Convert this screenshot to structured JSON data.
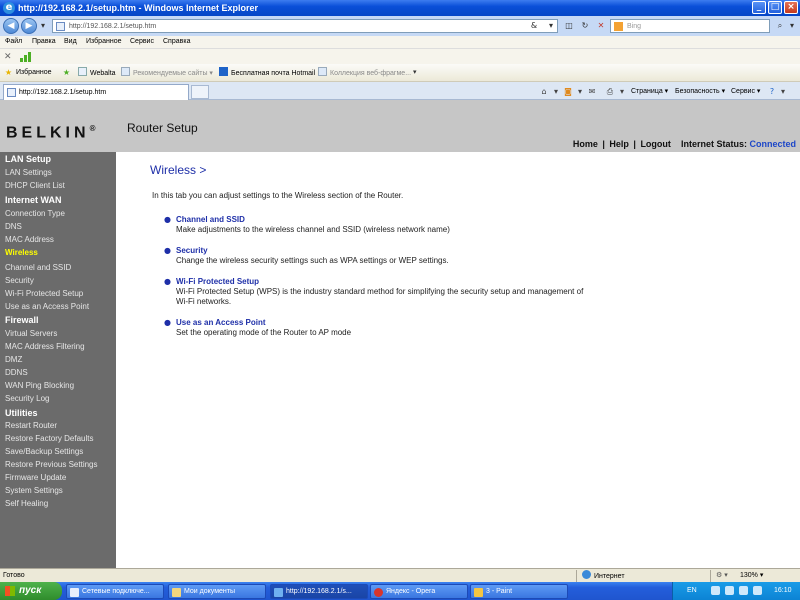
{
  "window": {
    "title": "http://192.168.2.1/setup.htm - Windows Internet Explorer",
    "controls": {
      "minimize": "_",
      "maximize": "□",
      "close": "×"
    }
  },
  "address_bar": {
    "url": "http://192.168.2.1/setup.htm",
    "search_placeholder": "Bing"
  },
  "menu": [
    "Файл",
    "Правка",
    "Вид",
    "Избранное",
    "Сервис",
    "Справка"
  ],
  "favorites_bar": {
    "favorites_label": "Избранное",
    "links": [
      {
        "label": "Webalta",
        "dim": false
      },
      {
        "label": "Рекомендуемые сайты ▾",
        "dim": true
      },
      {
        "label": "Бесплатная почта Hotmail",
        "dim": false
      },
      {
        "label": "Коллекция веб-фрагме...",
        "dim": true
      }
    ]
  },
  "tab": {
    "title": "http://192.168.2.1/setup.htm"
  },
  "command_bar": {
    "page": "Страница ▾",
    "safety": "Безопасность ▾",
    "tools": "Сервис ▾"
  },
  "header": {
    "logo": "BELKIN",
    "logo_mark": "®",
    "product": "Router Setup",
    "links": {
      "home": "Home",
      "help": "Help",
      "logout": "Logout"
    },
    "internet_status_label": "Internet Status:",
    "internet_status_value": "Connected",
    "status_color": "#1d47c8"
  },
  "sidebar": {
    "sections": [
      {
        "title": "LAN Setup",
        "items": [
          "LAN Settings",
          "DHCP Client List"
        ]
      },
      {
        "title": "Internet WAN",
        "items": [
          "Connection Type",
          "DNS",
          "MAC Address"
        ]
      },
      {
        "title": "Wireless",
        "active": true,
        "items": [
          "Channel and SSID",
          "Security",
          "Wi-Fi Protected Setup",
          "Use as an Access Point"
        ]
      },
      {
        "title": "Firewall",
        "items": [
          "Virtual Servers",
          "MAC Address Filtering",
          "DMZ",
          "DDNS",
          "WAN Ping Blocking",
          "Security Log"
        ]
      },
      {
        "title": "Utilities",
        "items": [
          "Restart Router",
          "Restore Factory Defaults",
          "Save/Backup Settings",
          "Restore Previous Settings",
          "Firmware Update",
          "System Settings",
          "Self Healing"
        ]
      }
    ]
  },
  "main": {
    "title": "Wireless >",
    "intro": "In this tab you can adjust settings to the Wireless section of the Router.",
    "bullet": "●",
    "entries": [
      {
        "heading": "Channel and SSID",
        "desc": "Make adjustments to the wireless channel and SSID (wireless network name)"
      },
      {
        "heading": "Security",
        "desc": "Change the wireless security settings such as WPA settings or WEP settings."
      },
      {
        "heading": "Wi-Fi Protected Setup",
        "desc": "Wi-Fi Protected Setup (WPS) is the industry standard method for simplifying the security setup and management of Wi-Fi networks."
      },
      {
        "heading": "Use as an Access Point",
        "desc": "Set the operating mode of the Router to AP mode"
      }
    ]
  },
  "status_bar": {
    "left": "Готово",
    "zone": "Интернет",
    "zoom": "130% ▾"
  },
  "taskbar": {
    "start": "пуск",
    "tasks": [
      {
        "label": "Сетевые подключе...",
        "active": false
      },
      {
        "label": "Мои документы",
        "active": false
      },
      {
        "label": "http://192.168.2.1/s...",
        "active": true
      },
      {
        "label": "Яндекс - Opera",
        "active": false
      },
      {
        "label": "3 - Paint",
        "active": false
      }
    ],
    "lang": "EN",
    "clock": "16:10"
  },
  "colors": {
    "sidebar_bg": "#6b6b6b",
    "active_item": "#ffff00",
    "heading_blue": "#1e2fa8",
    "header_gray": "#c6c6c6"
  }
}
